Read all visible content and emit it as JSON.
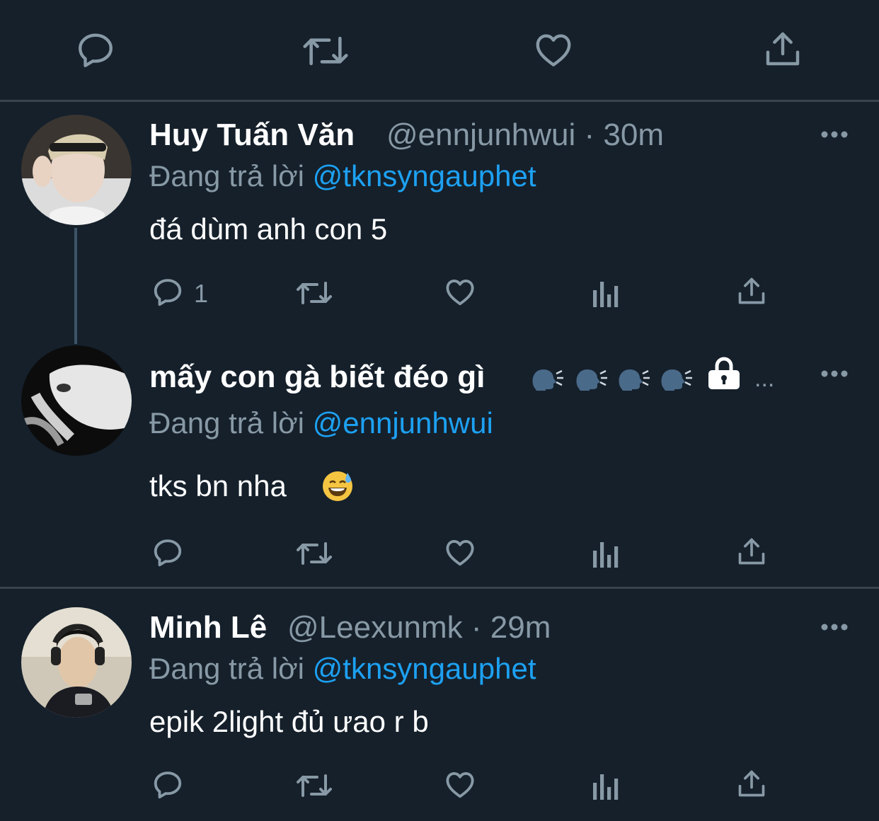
{
  "top_actions": [
    "reply-icon",
    "retweet-icon",
    "like-icon",
    "share-icon"
  ],
  "tweets": [
    {
      "name": "Huy Tuấn Văn",
      "handle": "@ennjunhwui",
      "separator": "·",
      "time": "30m",
      "reply_prefix": "Đang trả lời",
      "reply_to": "@tknsyngauphet",
      "text": "đá dùm anh con 5",
      "reply_count": "1",
      "avatar": "avatar-photo"
    },
    {
      "name": "mấy con gà biết đéo gì",
      "name_suffix": "...",
      "reply_prefix": "Đang trả lời",
      "reply_to": "@ennjunhwui",
      "text": "tks bn nha",
      "avatar": "avatar-photo",
      "name_icons": [
        "speaking-head-icon",
        "speaking-head-icon",
        "speaking-head-icon",
        "speaking-head-icon",
        "lock-icon"
      ],
      "text_emoji": "grinning-sweat-emoji"
    },
    {
      "name": "Minh Lê",
      "handle": "@Leexunmk",
      "separator": "·",
      "time": "29m",
      "reply_prefix": "Đang trả lời",
      "reply_to": "@tknsyngauphet",
      "text": "epik 2light đủ ưao r b",
      "avatar": "avatar-photo"
    }
  ],
  "colors": {
    "background": "#15202b",
    "divider": "#38444d",
    "muted": "#8899a6",
    "link": "#1da1f2",
    "text": "#ffffff"
  }
}
